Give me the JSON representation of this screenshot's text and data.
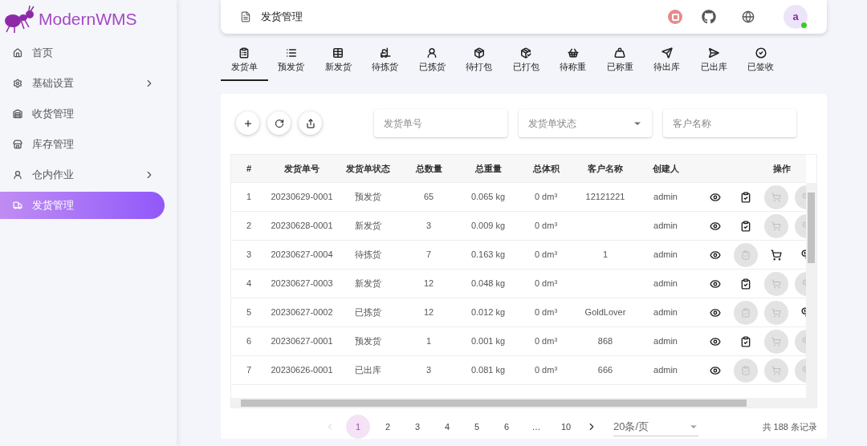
{
  "app": {
    "logo_text": "ModernWMS"
  },
  "sidebar": {
    "items": [
      {
        "label": "首页",
        "selected": false,
        "has_children": false
      },
      {
        "label": "基础设置",
        "selected": false,
        "has_children": true
      },
      {
        "label": "收货管理",
        "selected": false,
        "has_children": false
      },
      {
        "label": "库存管理",
        "selected": false,
        "has_children": false
      },
      {
        "label": "仓内作业",
        "selected": false,
        "has_children": true
      },
      {
        "label": "发货管理",
        "selected": true,
        "has_children": false
      }
    ]
  },
  "header": {
    "title": "发货管理",
    "avatar": "a",
    "online": true
  },
  "tabs": [
    {
      "label": "发货单",
      "selected": true
    },
    {
      "label": "预发货",
      "selected": false
    },
    {
      "label": "新发货",
      "selected": false
    },
    {
      "label": "待拣货",
      "selected": false
    },
    {
      "label": "已拣货",
      "selected": false
    },
    {
      "label": "待打包",
      "selected": false
    },
    {
      "label": "已打包",
      "selected": false
    },
    {
      "label": "待称重",
      "selected": false
    },
    {
      "label": "已称重",
      "selected": false
    },
    {
      "label": "待出库",
      "selected": false
    },
    {
      "label": "已出库",
      "selected": false
    },
    {
      "label": "已签收",
      "selected": false
    }
  ],
  "filters": [
    {
      "kind": "text",
      "placeholder": "发货单号"
    },
    {
      "kind": "select",
      "placeholder": "发货单状态"
    },
    {
      "kind": "text",
      "placeholder": "客户名称"
    }
  ],
  "table": {
    "columns": [
      "#",
      "发货单号",
      "发货单状态",
      "总数量",
      "总重量",
      "总体积",
      "客户名称",
      "创建人",
      "操作"
    ],
    "rows": [
      {
        "cells": [
          "1",
          "20230629-0001",
          "预发货",
          "65",
          "0.065 kg",
          "0 dm³",
          "12121221",
          "admin"
        ],
        "actions": [
          {
            "kind": "view",
            "disabled": false
          },
          {
            "kind": "check",
            "disabled": false
          },
          {
            "kind": "pick",
            "disabled": true
          },
          {
            "kind": "weigh",
            "disabled": true
          }
        ]
      },
      {
        "cells": [
          "2",
          "20230628-0001",
          "新发货",
          "3",
          "0.009 kg",
          "0 dm³",
          "",
          "admin"
        ],
        "actions": [
          {
            "kind": "view",
            "disabled": false
          },
          {
            "kind": "check",
            "disabled": false
          },
          {
            "kind": "pick",
            "disabled": true
          },
          {
            "kind": "weigh",
            "disabled": true
          }
        ]
      },
      {
        "cells": [
          "3",
          "20230627-0004",
          "待拣货",
          "7",
          "0.163 kg",
          "0 dm³",
          "1",
          "admin"
        ],
        "actions": [
          {
            "kind": "view",
            "disabled": false
          },
          {
            "kind": "check",
            "disabled": true
          },
          {
            "kind": "pick",
            "disabled": false
          },
          {
            "kind": "weigh",
            "disabled": false
          }
        ]
      },
      {
        "cells": [
          "4",
          "20230627-0003",
          "新发货",
          "12",
          "0.048 kg",
          "0 dm³",
          "",
          "admin"
        ],
        "actions": [
          {
            "kind": "view",
            "disabled": false
          },
          {
            "kind": "check",
            "disabled": false
          },
          {
            "kind": "pick",
            "disabled": true
          },
          {
            "kind": "weigh",
            "disabled": true
          }
        ]
      },
      {
        "cells": [
          "5",
          "20230627-0002",
          "已拣货",
          "12",
          "0.012 kg",
          "0 dm³",
          "GoldLover",
          "admin"
        ],
        "actions": [
          {
            "kind": "view",
            "disabled": false
          },
          {
            "kind": "check",
            "disabled": true
          },
          {
            "kind": "pick",
            "disabled": true
          },
          {
            "kind": "weigh",
            "disabled": false
          }
        ]
      },
      {
        "cells": [
          "6",
          "20230627-0001",
          "预发货",
          "1",
          "0.001 kg",
          "0 dm³",
          "868",
          "admin"
        ],
        "actions": [
          {
            "kind": "view",
            "disabled": false
          },
          {
            "kind": "check",
            "disabled": false
          },
          {
            "kind": "pick",
            "disabled": true
          },
          {
            "kind": "weigh",
            "disabled": true
          }
        ]
      },
      {
        "cells": [
          "7",
          "20230626-0001",
          "已出库",
          "3",
          "0.081 kg",
          "0 dm³",
          "666",
          "admin"
        ],
        "actions": [
          {
            "kind": "view",
            "disabled": false
          },
          {
            "kind": "check",
            "disabled": true
          },
          {
            "kind": "pick",
            "disabled": true
          },
          {
            "kind": "weigh",
            "disabled": true
          }
        ]
      }
    ]
  },
  "pagination": {
    "pages": [
      {
        "label": "1",
        "selected": true
      },
      {
        "label": "2",
        "selected": false
      },
      {
        "label": "3",
        "selected": false
      },
      {
        "label": "4",
        "selected": false
      },
      {
        "label": "5",
        "selected": false
      },
      {
        "label": "6",
        "selected": false
      },
      {
        "label": "…",
        "selected": false
      },
      {
        "label": "10",
        "selected": false
      }
    ],
    "page_size": "20条/页",
    "total": "共 188 条记录"
  }
}
